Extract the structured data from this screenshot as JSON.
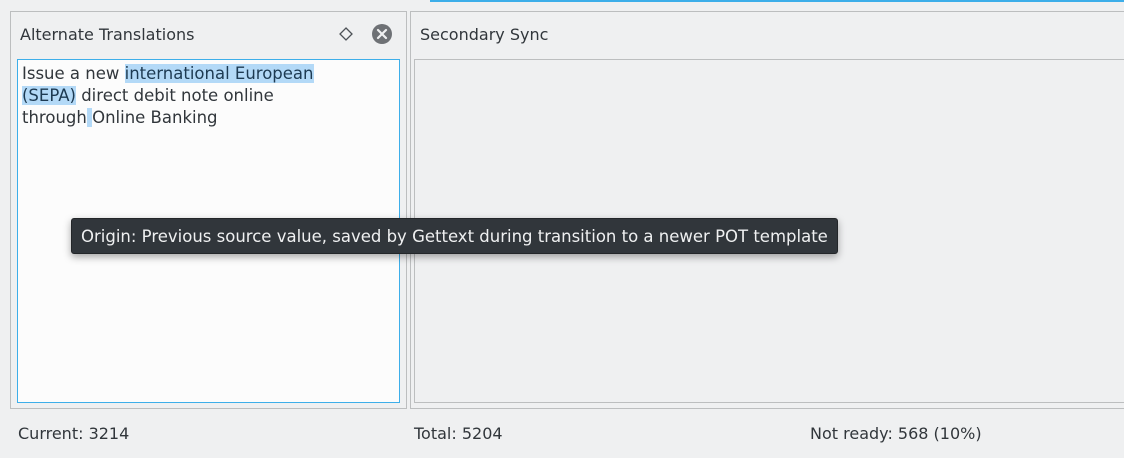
{
  "left_panel": {
    "title": "Alternate Translations",
    "float_icon": "diamond-float-icon",
    "close_icon": "close-circle-icon",
    "text": {
      "part1": "Issue a new ",
      "part2_highlight": "international European",
      "part3_highlight": "(SEPA)",
      "part4": " direct debit note online",
      "part5": "through",
      "part6_highlight": " ",
      "part7": "Online Banking"
    }
  },
  "right_panel": {
    "title": "Secondary Sync"
  },
  "tooltip": {
    "text": "Origin: Previous source value, saved by Gettext during transition to a newer POT template"
  },
  "status_bar": {
    "current": "Current: 3214",
    "total": "Total: 5204",
    "not_ready": "Not ready: 568 (10%)"
  },
  "colors": {
    "accent": "#3daee9",
    "highlight": "#b3d9f7",
    "tooltip_bg": "#31363b",
    "background": "#eff0f1"
  }
}
